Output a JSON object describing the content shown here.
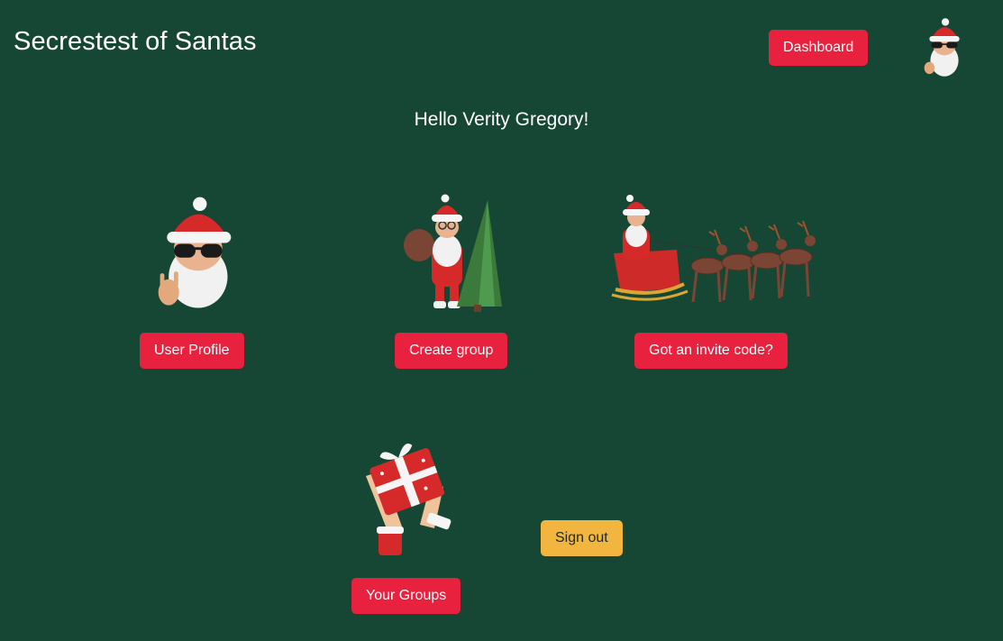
{
  "header": {
    "title": "Secrestest of Santas",
    "dashboard_label": "Dashboard",
    "avatar_icon": "santa-avatar-icon"
  },
  "greeting": "Hello Verity Gregory!",
  "cards": [
    {
      "icon": "santa-sunglasses-icon",
      "button_label": "User Profile"
    },
    {
      "icon": "santa-tree-icon",
      "button_label": "Create group"
    },
    {
      "icon": "santa-sleigh-icon",
      "button_label": "Got an invite code?"
    },
    {
      "icon": "gift-hands-icon",
      "button_label": "Your Groups"
    }
  ],
  "sign_out_label": "Sign out",
  "colors": {
    "background": "#154734",
    "primary_button": "#e8213f",
    "secondary_button": "#f2b540"
  }
}
